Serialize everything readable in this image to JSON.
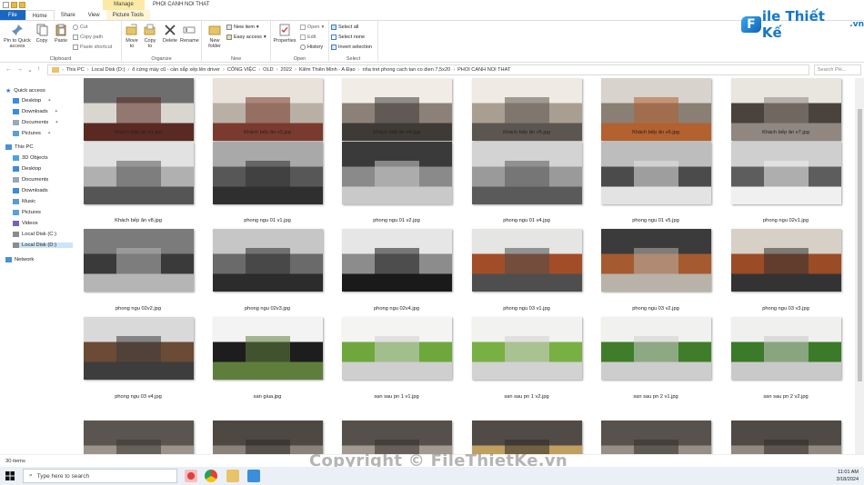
{
  "window": {
    "title": "PHOI CANH NOI THAT",
    "manage_tab": "Manage"
  },
  "tabs": {
    "file": "File",
    "home": "Home",
    "share": "Share",
    "view": "View",
    "picture_tools": "Picture Tools"
  },
  "ribbon": {
    "clipboard": {
      "label": "Clipboard",
      "pin": "Pin to Quick access",
      "copy": "Copy",
      "paste": "Paste",
      "cut": "Cut",
      "copy_path": "Copy path",
      "paste_shortcut": "Paste shortcut"
    },
    "organize": {
      "label": "Organize",
      "move_to": "Move to",
      "copy_to": "Copy to",
      "delete": "Delete",
      "rename": "Rename"
    },
    "new": {
      "label": "New",
      "new_folder": "New folder",
      "new_item": "New item",
      "easy_access": "Easy access"
    },
    "open": {
      "label": "Open",
      "properties": "Properties",
      "open": "Open",
      "edit": "Edit",
      "history": "History"
    },
    "select": {
      "label": "Select",
      "select_all": "Select all",
      "select_none": "Select none",
      "invert": "Invert selection"
    }
  },
  "logo": {
    "ban": "F",
    "text": "ile Thiết Kế",
    "suffix": ".vn"
  },
  "address": {
    "segments": [
      "This PC",
      "Local Disk (D:)",
      "ổ cứng máy cũ - cần sắp xếp lên driver",
      "CÔNG VIỆC",
      "OLD",
      "2022",
      "Kiểm Thiên Minh - A Đạo",
      "nha tret phong cach tan co dien 7,5x20",
      "PHOI CANH NOI THAT"
    ],
    "search_placeholder": "Search PH..."
  },
  "nav": {
    "quick_access": "Quick access",
    "desktop": "Desktop",
    "downloads": "Downloads",
    "documents": "Documents",
    "pictures": "Pictures",
    "this_pc": "This PC",
    "objects3d": "3D Objects",
    "desktop2": "Desktop",
    "documents2": "Documents",
    "downloads2": "Downloads",
    "music": "Music",
    "pictures2": "Pictures",
    "videos": "Videos",
    "local_c": "Local Disk (C:)",
    "local_d": "Local Disk (D:)",
    "network": "Network"
  },
  "files": [
    {
      "name": "Khách bếp ăn v1.jpg",
      "c1": "#6e6e6e",
      "c2": "#d9d6d0",
      "c3": "#5a2a22"
    },
    {
      "name": "Khách bếp ăn v3.jpg",
      "c1": "#e8e2da",
      "c2": "#b9b0a5",
      "c3": "#7a3b2e"
    },
    {
      "name": "Khách bếp ăn v4.jpg",
      "c1": "#f1ede6",
      "c2": "#8c8178",
      "c3": "#3e3a36"
    },
    {
      "name": "Khách bếp ăn v5.jpg",
      "c1": "#efeae3",
      "c2": "#a99e92",
      "c3": "#5c5650"
    },
    {
      "name": "Khách bếp ăn v6.jpg",
      "c1": "#d8d3cc",
      "c2": "#8a7f75",
      "c3": "#b3612f"
    },
    {
      "name": "Khách bếp ăn v7.jpg",
      "c1": "#e9e5df",
      "c2": "#4a423c",
      "c3": "#8f8780"
    },
    {
      "name": "Khách bếp ăn v8.jpg",
      "c1": "#e2e2e2",
      "c2": "#b0b0b0",
      "c3": "#555555"
    },
    {
      "name": "phong ngu 01 v1.jpg",
      "c1": "#a9a9a9",
      "c2": "#575757",
      "c3": "#2f2f2f"
    },
    {
      "name": "phong ngu 01 v2.jpg",
      "c1": "#3a3a3a",
      "c2": "#8a8a8a",
      "c3": "#c9c9c9"
    },
    {
      "name": "phong ngu 01 v4.jpg",
      "c1": "#d3d3d3",
      "c2": "#9a9a9a",
      "c3": "#5a5a5a"
    },
    {
      "name": "phong ngu 01 v5.jpg",
      "c1": "#bdbdbd",
      "c2": "#4b4b4b",
      "c3": "#e3e3e3"
    },
    {
      "name": "phong ngu 02v1.jpg",
      "c1": "#cfcfcf",
      "c2": "#5d5d5d",
      "c3": "#f0f0f0"
    },
    {
      "name": "phong ngu 02v2.jpg",
      "c1": "#7b7b7b",
      "c2": "#3a3a3a",
      "c3": "#b5b5b5"
    },
    {
      "name": "phong ngu 02v3.jpg",
      "c1": "#c6c6c6",
      "c2": "#6a6a6a",
      "c3": "#2c2c2c"
    },
    {
      "name": "phong ngu 02v4.jpg",
      "c1": "#e6e6e6",
      "c2": "#8c8c8c",
      "c3": "#1a1a1a"
    },
    {
      "name": "phong ngu 03 v1.jpg",
      "c1": "#e5e5e3",
      "c2": "#a24d28",
      "c3": "#4e4e4e"
    },
    {
      "name": "phong ngu 03 v2.jpg",
      "c1": "#3b3b3b",
      "c2": "#a65a30",
      "c3": "#b8b2a9"
    },
    {
      "name": "phong ngu 03 v3.jpg",
      "c1": "#d7d0c6",
      "c2": "#9b4b26",
      "c3": "#333333"
    },
    {
      "name": "phong ngu 03 v4.jpg",
      "c1": "#d9d9d9",
      "c2": "#6b4a36",
      "c3": "#3d3d3d"
    },
    {
      "name": "san giua.jpg",
      "c1": "#f3f3f3",
      "c2": "#1d1d1d",
      "c3": "#5e7f3c"
    },
    {
      "name": "san sau pn 1 v1.jpg",
      "c1": "#f4f4f2",
      "c2": "#6ea83c",
      "c3": "#cfcfcf"
    },
    {
      "name": "san sau pn 1 v2.jpg",
      "c1": "#f2f2f0",
      "c2": "#78b043",
      "c3": "#d2d2d2"
    },
    {
      "name": "san sau pn 2 v1.jpg",
      "c1": "#f1f1ef",
      "c2": "#3f7d2a",
      "c3": "#cdcdcd"
    },
    {
      "name": "san sau pn 2 v2.jpg",
      "c1": "#f0f0ee",
      "c2": "#3a7a28",
      "c3": "#c9c9c9"
    },
    {
      "name": "",
      "c1": "#5a5550",
      "c2": "#9c948a",
      "c3": "#3a3632"
    },
    {
      "name": "",
      "c1": "#4d4842",
      "c2": "#8b8379",
      "c3": "#2e2a26"
    },
    {
      "name": "",
      "c1": "#55504b",
      "c2": "#a39a8f",
      "c3": "#35312d"
    },
    {
      "name": "",
      "c1": "#504b46",
      "c2": "#c0a060",
      "c3": "#302c28"
    },
    {
      "name": "",
      "c1": "#57524d",
      "c2": "#978f85",
      "c3": "#332f2b"
    },
    {
      "name": "",
      "c1": "#4f4a45",
      "c2": "#928a80",
      "c3": "#2f2b27"
    }
  ],
  "status": {
    "items": "30 items"
  },
  "watermark": "Copyright © FileThietKe.vn",
  "taskbar": {
    "search_placeholder": "Type here to search",
    "time": "11:01 AM",
    "date": "3/18/2024"
  }
}
